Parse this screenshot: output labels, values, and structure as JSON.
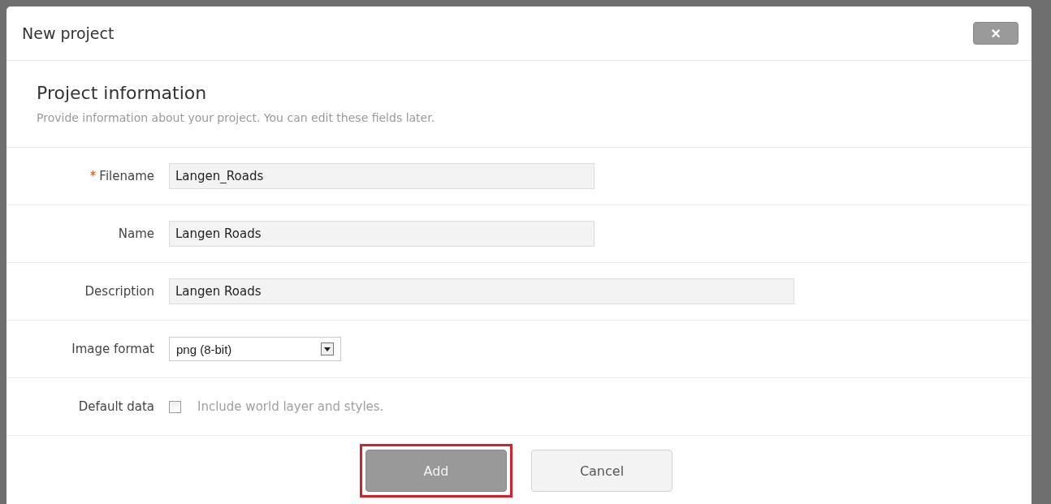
{
  "dialog": {
    "title": "New project",
    "close_label": "×"
  },
  "section": {
    "heading": "Project information",
    "description": "Provide information about your project. You can edit these fields later."
  },
  "fields": [
    {
      "kind": "text",
      "label": "Filename",
      "required": true,
      "value": "Langen_Roads",
      "wide": false
    },
    {
      "kind": "text",
      "label": "Name",
      "required": false,
      "value": "Langen Roads",
      "wide": false
    },
    {
      "kind": "text",
      "label": "Description",
      "required": false,
      "value": "Langen Roads",
      "wide": true
    },
    {
      "kind": "select",
      "label": "Image format",
      "required": false,
      "value": "png (8-bit)"
    },
    {
      "kind": "checkbox",
      "label": "Default data",
      "required": false,
      "checked": false,
      "hint": "Include world layer and styles."
    }
  ],
  "required_mark": "*",
  "buttons": [
    {
      "label": "Add",
      "kind": "primary",
      "highlighted": true
    },
    {
      "label": "Cancel",
      "kind": "secondary",
      "highlighted": false
    }
  ]
}
